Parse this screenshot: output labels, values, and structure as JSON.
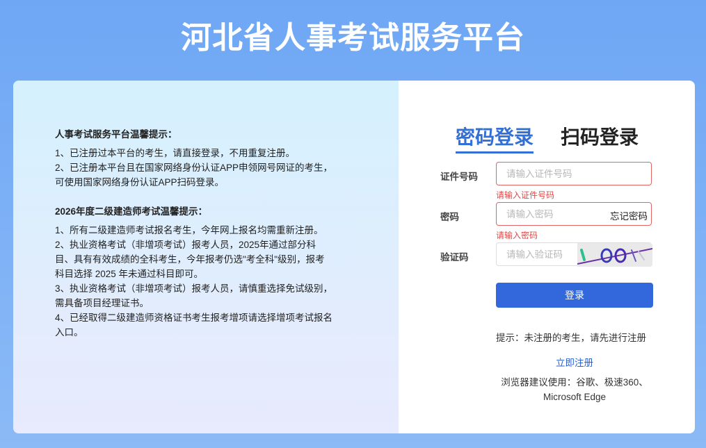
{
  "header": {
    "title": "河北省人事考试服务平台"
  },
  "notice1": {
    "heading": "人事考试服务平台温馨提示：",
    "items": [
      "1、已注册过本平台的考生，请直接登录，不用重复注册。",
      "2、已注册本平台且在国家网络身份认证APP申领网号网证的考生，可使用国家网络身份认证APP扫码登录。"
    ]
  },
  "notice2": {
    "heading": "2026年度二级建造师考试温馨提示：",
    "items": [
      "1、所有二级建造师考试报名考生，今年网上报名均需重新注册。",
      "2、执业资格考试（非增项考试）报考人员，2025年通过部分科目、具有有效成绩的全科考生，今年报考仍选\"考全科\"级别，报考科目选择 2025 年未通过科目即可。",
      "3、执业资格考试（非增项考试）报考人员，请慎重选择免试级别，需具备项目经理证书。",
      "4、已经取得二级建造师资格证书考生报考增项请选择增项考试报名入口。"
    ]
  },
  "login": {
    "tab_password": "密码登录",
    "tab_qr": "扫码登录",
    "id_label": "证件号码",
    "id_placeholder": "请输入证件号码",
    "id_error": "请输入证件号码",
    "pwd_label": "密码",
    "pwd_placeholder": "请输入密码",
    "pwd_error": "请输入密码",
    "forgot": "忘记密码",
    "captcha_label": "验证码",
    "captcha_placeholder": "请输入验证码",
    "submit": "登录",
    "hint": "提示：未注册的考生，请先进行注册",
    "register": "立即注册",
    "browser_line1": "浏览器建议使用：谷歌、极速360、",
    "browser_line2": "Microsoft Edge"
  },
  "colors": {
    "accent": "#3368dd",
    "error": "#e04848"
  }
}
